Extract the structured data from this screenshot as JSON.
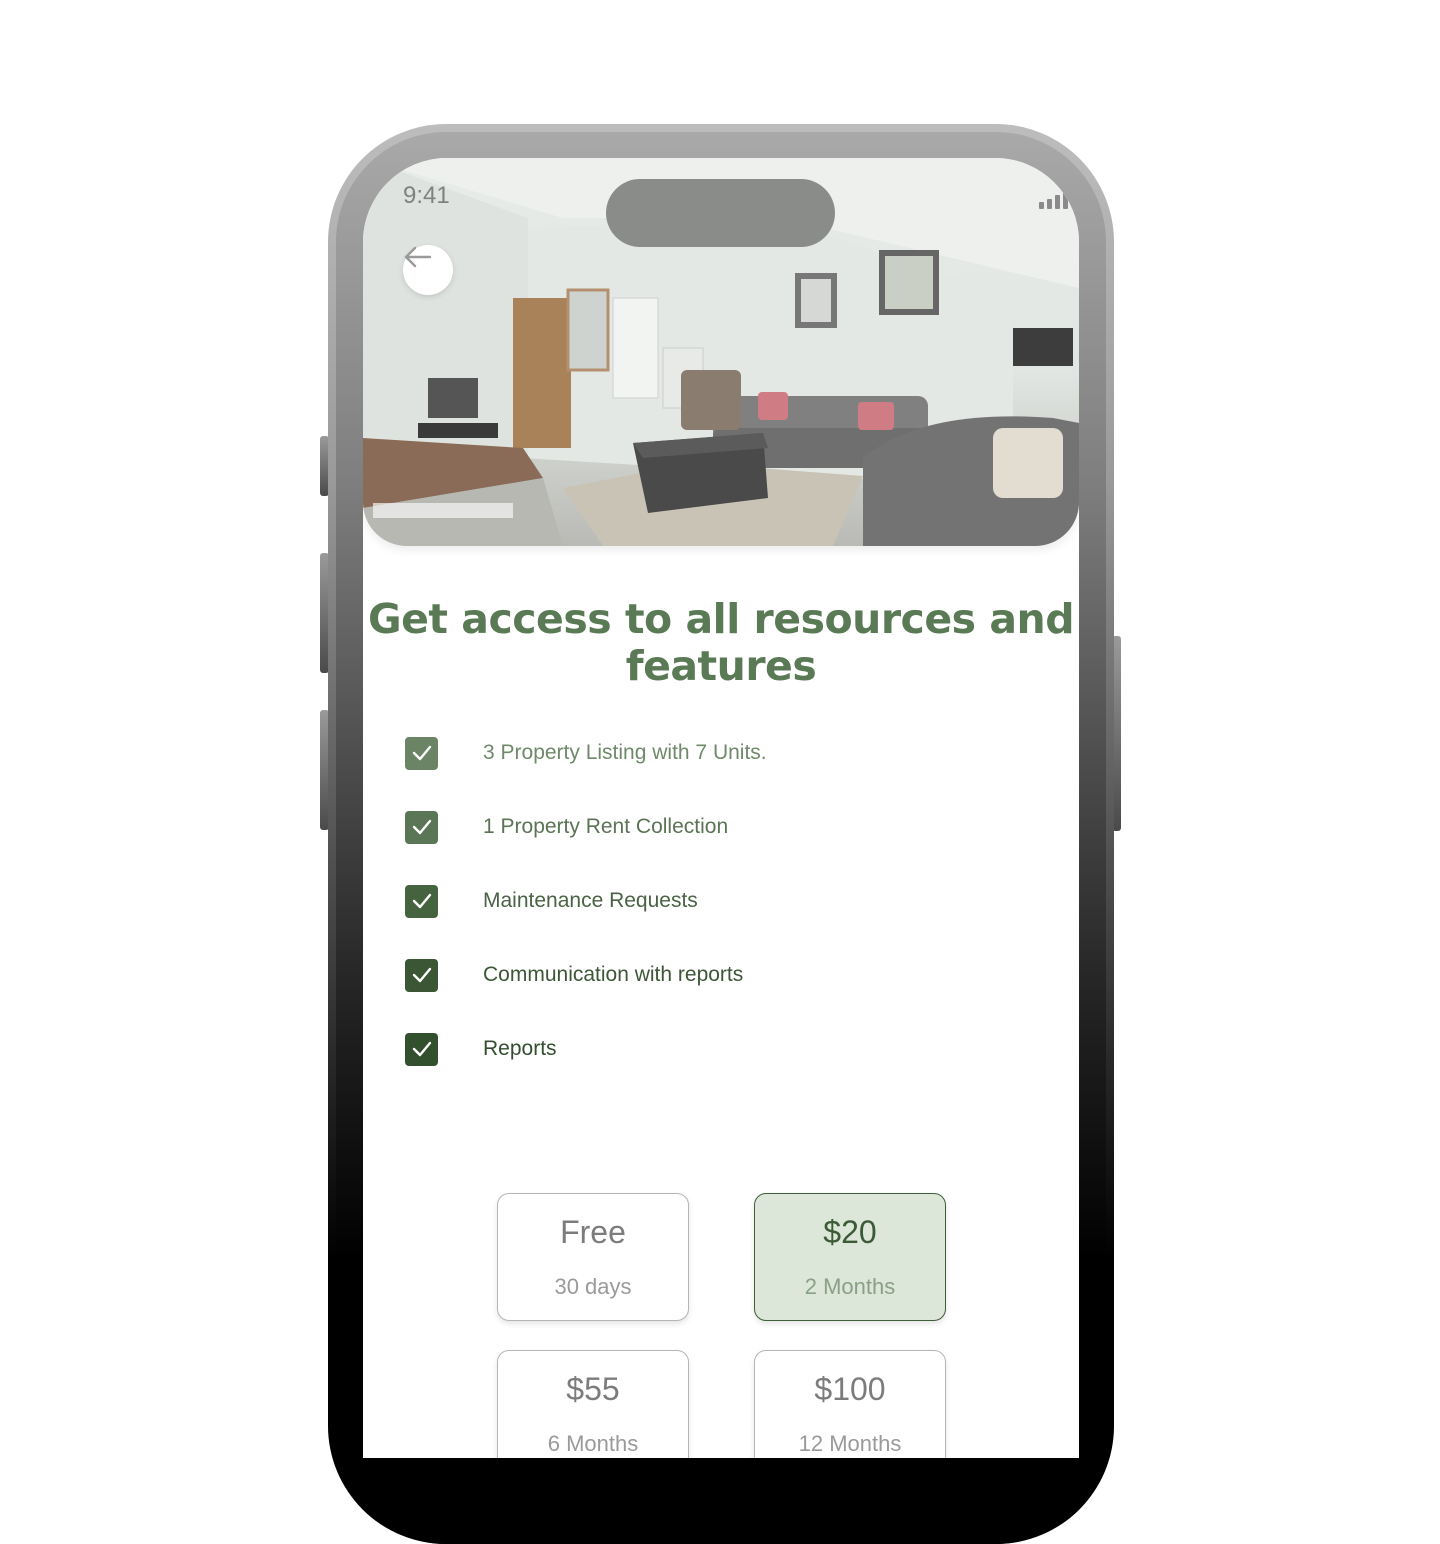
{
  "status_bar": {
    "time": "9:41"
  },
  "header": {
    "title": "Get access to all resources and features"
  },
  "features": [
    {
      "label": "3 Property Listing with 7 Units.",
      "checked": true
    },
    {
      "label": "1 Property Rent Collection",
      "checked": true
    },
    {
      "label": "Maintenance Requests",
      "checked": true
    },
    {
      "label": "Communication with reports",
      "checked": true
    },
    {
      "label": "Reports",
      "checked": true
    }
  ],
  "plans": [
    {
      "price": "Free",
      "period": "30 days",
      "selected": false
    },
    {
      "price": "$20",
      "period": "2 Months",
      "selected": true
    },
    {
      "price": "$55",
      "period": "6 Months",
      "selected": false
    },
    {
      "price": "$100",
      "period": "12 Months",
      "selected": false
    }
  ],
  "icons": {
    "back": "arrow-left-icon",
    "check": "checkmark-icon",
    "signal": "cellular-signal-icon",
    "wifi": "wifi-icon",
    "battery": "battery-icon"
  },
  "colors": {
    "accent": "#3f5e3a",
    "title": "#5a7a55",
    "selected_plan_bg": "#dce7d9"
  }
}
